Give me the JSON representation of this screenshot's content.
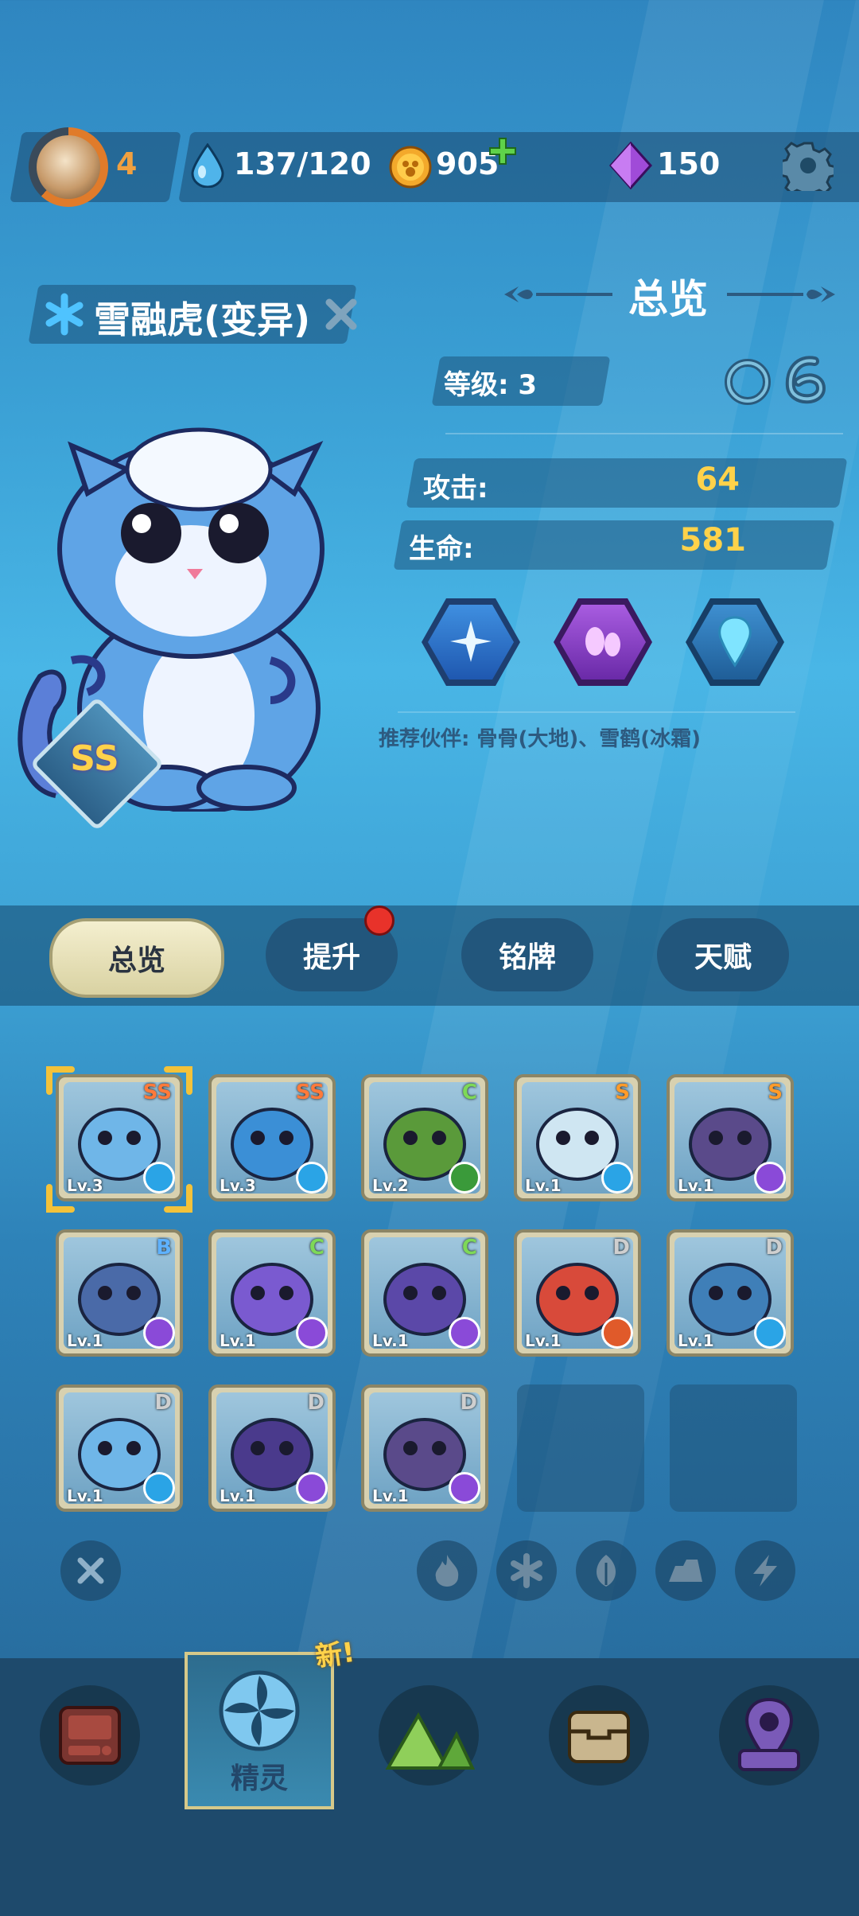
{
  "topbar": {
    "player_level": "4",
    "energy": "137/120",
    "coins": "905",
    "gems": "150"
  },
  "pet": {
    "name": "雪融虎(变异)",
    "rank": "SS"
  },
  "overview": {
    "title": "总览",
    "level_label": "等级: 3",
    "attack_label": "攻击:",
    "attack_value": "64",
    "hp_label": "生命:",
    "hp_value": "581",
    "recommend": "推荐伙伴: 骨骨(大地)、雪鹤(冰霜)"
  },
  "tabs": [
    {
      "label": "总览"
    },
    {
      "label": "提升"
    },
    {
      "label": "铭牌"
    },
    {
      "label": "天赋"
    }
  ],
  "pets": [
    {
      "rank": "SS",
      "level": "Lv.3",
      "element": "ice",
      "color": "#6fb6e8"
    },
    {
      "rank": "SS",
      "level": "Lv.3",
      "element": "ice",
      "color": "#3b8fd6"
    },
    {
      "rank": "C",
      "level": "Lv.2",
      "element": "leaf",
      "color": "#5a9a3a"
    },
    {
      "rank": "S",
      "level": "Lv.1",
      "element": "ice",
      "color": "#cfe6f2"
    },
    {
      "rank": "S",
      "level": "Lv.1",
      "element": "thunder",
      "color": "#5a4a8a"
    },
    {
      "rank": "B",
      "level": "Lv.1",
      "element": "thunder",
      "color": "#4a6aa8"
    },
    {
      "rank": "C",
      "level": "Lv.1",
      "element": "thunder",
      "color": "#7a5ad0"
    },
    {
      "rank": "C",
      "level": "Lv.1",
      "element": "thunder",
      "color": "#5b48a8"
    },
    {
      "rank": "D",
      "level": "Lv.1",
      "element": "fire",
      "color": "#d84a3a"
    },
    {
      "rank": "D",
      "level": "Lv.1",
      "element": "ice",
      "color": "#3f7fb8"
    },
    {
      "rank": "D",
      "level": "Lv.1",
      "element": "ice",
      "color": "#6fb6e8"
    },
    {
      "rank": "D",
      "level": "Lv.1",
      "element": "thunder",
      "color": "#4a3a8c"
    },
    {
      "rank": "D",
      "level": "Lv.1",
      "element": "thunder",
      "color": "#5a4a8a"
    }
  ],
  "nav": {
    "spirit_label": "精灵",
    "new_badge": "新!"
  },
  "colors": {
    "rank_ss": "#ff7a3a",
    "rank_s": "#ff9b2a",
    "rank_c": "#7ed957",
    "rank_d": "#cfcfcf",
    "rank_b": "#5fb2ff",
    "stat_value": "#ffd24a"
  }
}
